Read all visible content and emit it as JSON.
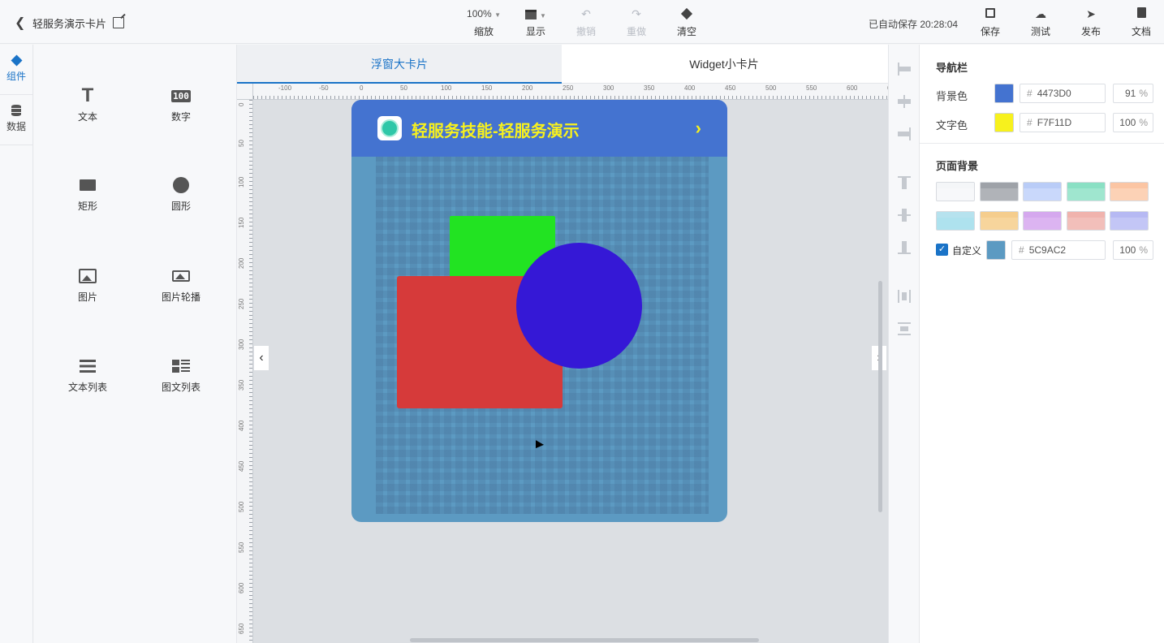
{
  "header": {
    "title": "轻服务演示卡片",
    "zoom": {
      "value": "100%",
      "label": "缩放"
    },
    "display_label": "显示",
    "undo_label": "撤销",
    "redo_label": "重做",
    "clear_label": "清空",
    "autosave": "已自动保存 20:28:04",
    "save_label": "保存",
    "test_label": "测试",
    "publish_label": "发布",
    "docs_label": "文档"
  },
  "rail": {
    "components_label": "组件",
    "data_label": "数据"
  },
  "palette": {
    "items": [
      {
        "label": "文本",
        "icon": "text-icon"
      },
      {
        "label": "数字",
        "icon": "number-icon",
        "icon_text": "100"
      },
      {
        "label": "矩形",
        "icon": "rectangle-icon"
      },
      {
        "label": "圆形",
        "icon": "circle-icon"
      },
      {
        "label": "图片",
        "icon": "image-icon"
      },
      {
        "label": "图片轮播",
        "icon": "carousel-icon"
      },
      {
        "label": "文本列表",
        "icon": "text-list-icon"
      },
      {
        "label": "图文列表",
        "icon": "image-text-list-icon"
      }
    ]
  },
  "tabs": [
    {
      "label": "浮窗大卡片",
      "active": true
    },
    {
      "label": "Widget小卡片",
      "active": false
    }
  ],
  "ruler": {
    "h_labels": [
      "-100",
      "-50",
      "0",
      "50",
      "100",
      "150",
      "200",
      "250",
      "300",
      "350",
      "400",
      "450",
      "500",
      "550",
      "600",
      "650"
    ],
    "v_labels": [
      "0",
      "50",
      "100",
      "150",
      "200",
      "250",
      "300",
      "350",
      "400",
      "450",
      "500",
      "550",
      "600",
      "650"
    ]
  },
  "card": {
    "title": "轻服务技能-轻服务演示",
    "nav_bg": "#4473D0",
    "nav_text_color": "#F7F11D",
    "page_bg": "#5C9AC2",
    "shapes": {
      "green": "#22E322",
      "red": "#D63A3A",
      "blue": "#3518D6"
    }
  },
  "props": {
    "nav_section": "导航栏",
    "bg_label": "背景色",
    "bg_hex": "4473D0",
    "bg_opacity": "91",
    "text_color_label": "文字色",
    "text_hex": "F7F11D",
    "text_opacity": "100",
    "page_bg_section": "页面背景",
    "presets": [
      {
        "top": "#f4f6f8",
        "body": "#f7f8fa"
      },
      {
        "top": "#9ea2a8",
        "body": "#b0b3b8"
      },
      {
        "top": "#b9ccf7",
        "body": "#c9d8fb"
      },
      {
        "top": "#8ae0c4",
        "body": "#9fe6cf"
      },
      {
        "top": "#fbc5a3",
        "body": "#fcd2b6"
      },
      {
        "top": "#b6e2ee",
        "body": "#aee2ee"
      },
      {
        "top": "#f5cd8d",
        "body": "#f7d59c"
      },
      {
        "top": "#d5a8ee",
        "body": "#dcb4f1"
      },
      {
        "top": "#f0b3ad",
        "body": "#f2bfba"
      },
      {
        "top": "#b6b9f3",
        "body": "#c3c6f6"
      }
    ],
    "custom_label": "自定义",
    "custom_hex": "5C9AC2",
    "custom_opacity": "100",
    "hash": "#",
    "percent": "%"
  }
}
